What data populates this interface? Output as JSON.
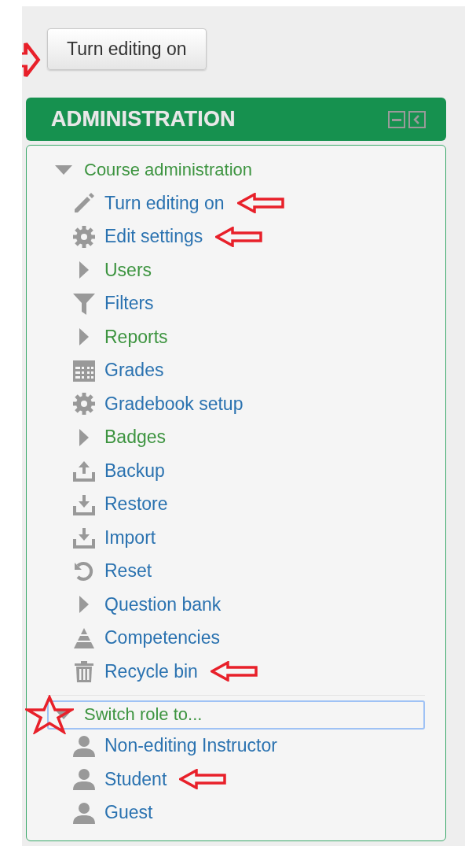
{
  "edit_button": {
    "label": "Turn editing on",
    "arrow": true
  },
  "block": {
    "title": "ADMINISTRATION"
  },
  "tree": [
    {
      "label": "Course administration",
      "expanded": true,
      "focused": false,
      "starred": false,
      "children": [
        {
          "label": "Turn editing on",
          "kind": "link",
          "arrow": true
        },
        {
          "label": "Edit settings",
          "kind": "link",
          "arrow": true
        },
        {
          "label": "Users",
          "kind": "branch",
          "expanded": false,
          "arrow": false
        },
        {
          "label": "Filters",
          "kind": "link",
          "arrow": false
        },
        {
          "label": "Reports",
          "kind": "branch",
          "expanded": false,
          "arrow": false
        },
        {
          "label": "Grades",
          "kind": "link",
          "arrow": false
        },
        {
          "label": "Gradebook setup",
          "kind": "link",
          "arrow": false
        },
        {
          "label": "Badges",
          "kind": "branch",
          "expanded": false,
          "arrow": false
        },
        {
          "label": "Backup",
          "kind": "link",
          "arrow": false
        },
        {
          "label": "Restore",
          "kind": "link",
          "arrow": false
        },
        {
          "label": "Import",
          "kind": "link",
          "arrow": false
        },
        {
          "label": "Reset",
          "kind": "link",
          "arrow": false
        },
        {
          "label": "Question bank",
          "kind": "link_branch",
          "expanded": false,
          "arrow": false
        },
        {
          "label": "Competencies",
          "kind": "link",
          "arrow": false
        },
        {
          "label": "Recycle bin",
          "kind": "link",
          "arrow": true
        }
      ]
    },
    {
      "label": "Switch role to...",
      "expanded": true,
      "focused": true,
      "starred": true,
      "children": [
        {
          "label": "Non-editing Instructor",
          "kind": "link",
          "arrow": false
        },
        {
          "label": "Student",
          "kind": "link",
          "arrow": true
        },
        {
          "label": "Guest",
          "kind": "link",
          "arrow": false
        }
      ]
    }
  ]
}
